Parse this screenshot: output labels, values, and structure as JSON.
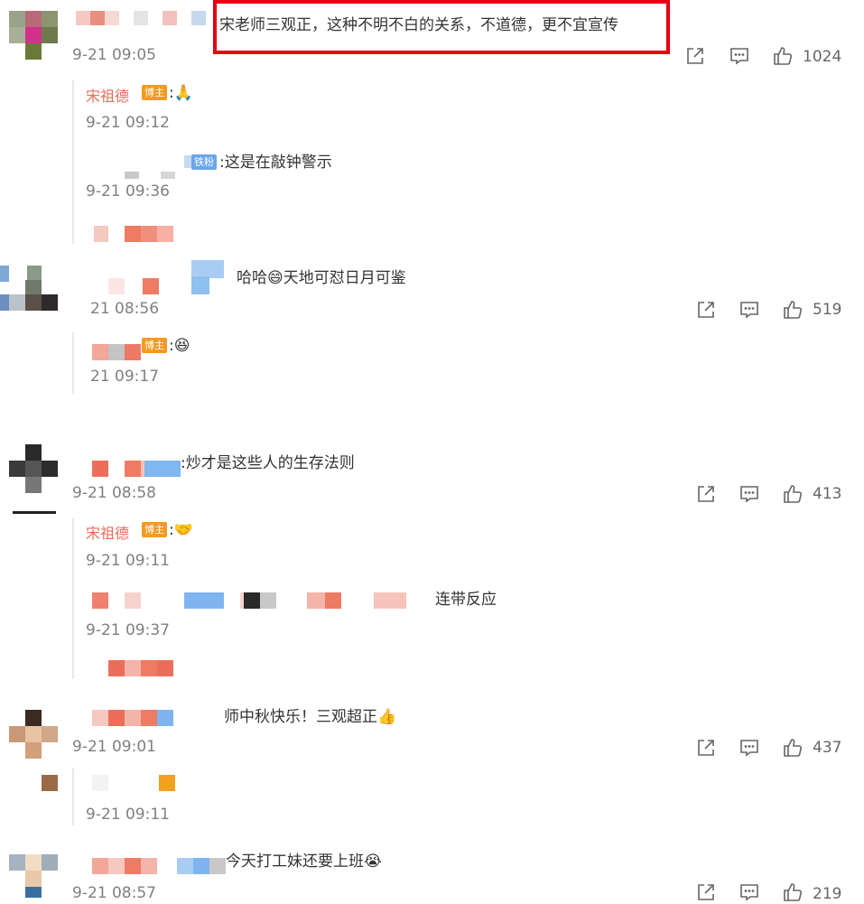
{
  "colors": {
    "highlight_box": "#e60012",
    "blogger_badge": "#f29a22",
    "fan_badge": "#6aa6ea",
    "secondary_text": "#808080"
  },
  "comments": [
    {
      "text": "宋老师三观正，这种不明不白的关系，不道德，更不宜宣传",
      "time": "9-21 09:05",
      "likes": "1024",
      "replies": [
        {
          "author": "宋祖德",
          "badge": "博主",
          "text": ":🙏",
          "time": "9-21 09:12"
        },
        {
          "badge": "铁粉",
          "text": ":这是在敲钟警示",
          "time": "9-21 09:36"
        }
      ]
    },
    {
      "text": "哈哈😄天地可怼日月可鉴",
      "time": "21 08:56",
      "likes": "519",
      "replies": [
        {
          "badge": "博主",
          "text": ":😆",
          "time": "21 09:17"
        }
      ]
    },
    {
      "text": ":炒才是这些人的生存法则",
      "time": "9-21 08:58",
      "likes": "413",
      "replies": [
        {
          "author": "宋祖德",
          "badge": "博主",
          "text": ":🤝",
          "time": "9-21 09:11"
        },
        {
          "text": "连带反应",
          "time": "9-21 09:37"
        }
      ]
    },
    {
      "text": "师中秋快乐！三观超正👍",
      "time": "9-21 09:01",
      "likes": "437",
      "replies": [
        {
          "time": "9-21 09:11"
        }
      ]
    },
    {
      "text": "今天打工妹还要上班😭",
      "time": "9-21 08:57",
      "likes": "219"
    }
  ],
  "icons": {
    "share": "share-icon",
    "comment": "comment-icon",
    "like": "thumbs-up-icon"
  }
}
